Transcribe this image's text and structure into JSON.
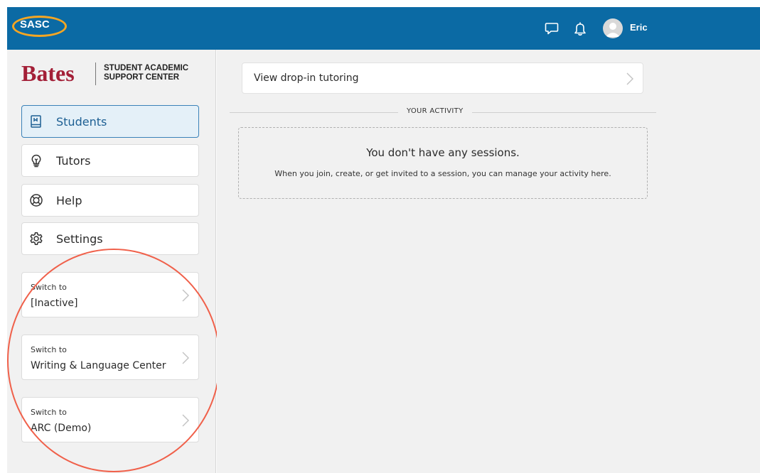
{
  "header": {
    "brand_short": "SASC",
    "user_name": "Eric",
    "colors": {
      "bar": "#0b6aa4",
      "highlight_ring": "#f5a623"
    }
  },
  "logo": {
    "word": "Bates",
    "subtitle": "STUDENT ACADEMIC SUPPORT CENTER"
  },
  "sidebar": {
    "nav": [
      {
        "label": "Students",
        "icon": "book-icon",
        "active": true
      },
      {
        "label": "Tutors",
        "icon": "lightbulb-icon",
        "active": false
      },
      {
        "label": "Help",
        "icon": "lifebuoy-icon",
        "active": false
      },
      {
        "label": "Settings",
        "icon": "gear-icon",
        "active": false
      }
    ],
    "switch_cards": [
      {
        "small": "Switch to",
        "main": "[Inactive]"
      },
      {
        "small": "Switch to",
        "main": "Writing & Language Center"
      },
      {
        "small": "Switch to",
        "main": "ARC (Demo)"
      }
    ],
    "annotation_color": "#f0604a"
  },
  "main": {
    "dropin_label": "View drop-in tutoring",
    "activity_title": "YOUR ACTIVITY",
    "empty_title": "You don't have any sessions.",
    "empty_text": "When you join, create, or get invited to a session, you can manage your activity here."
  }
}
